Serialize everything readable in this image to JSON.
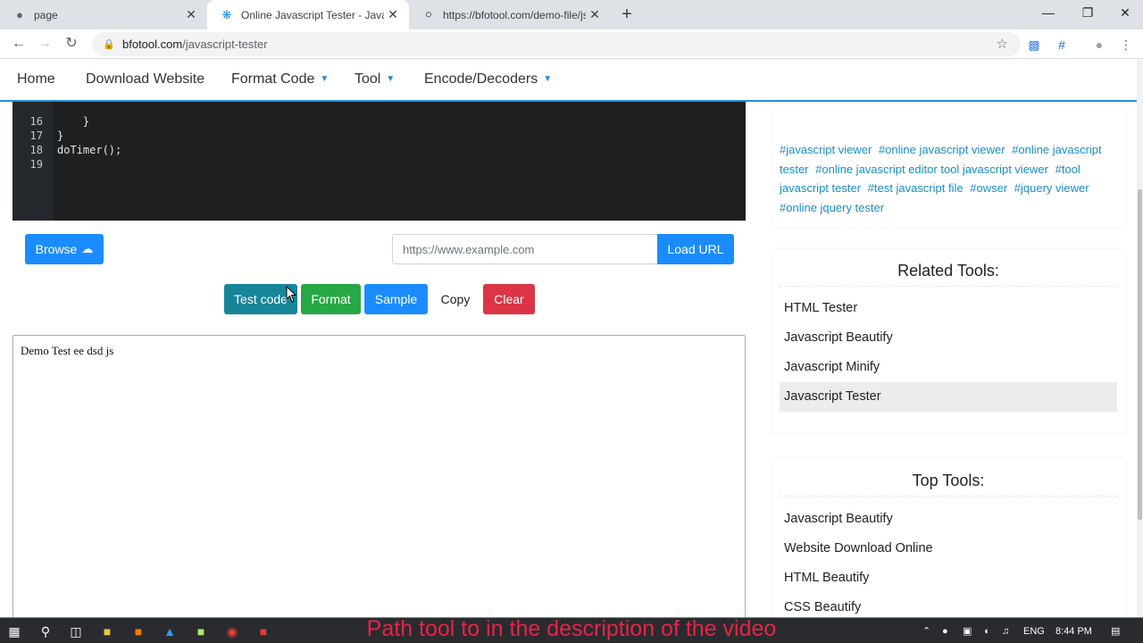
{
  "browser": {
    "tabs": [
      {
        "title": "page",
        "icon": "github-icon"
      },
      {
        "title": "Online Javascript Tester - Javascri",
        "icon": "bfotool-icon"
      },
      {
        "title": "https://bfotool.com/demo-file/js",
        "icon": "globe-icon"
      }
    ],
    "url_host": "bfotool.com",
    "url_path": "/javascript-tester"
  },
  "nav": {
    "home": "Home",
    "download": "Download Website",
    "format": "Format Code",
    "tool": "Tool",
    "encode": "Encode/Decoders",
    "caret": "▼"
  },
  "editor": {
    "lines": [
      {
        "num": "16",
        "text": "    }"
      },
      {
        "num": "17",
        "text": "}"
      },
      {
        "num": "18",
        "text": "doTimer();"
      },
      {
        "num": "19",
        "text": ""
      }
    ]
  },
  "controls": {
    "browse": "Browse",
    "url_placeholder": "https://www.example.com",
    "load_url": "Load URL",
    "test_code": "Test code",
    "format": "Format",
    "sample": "Sample",
    "copy": "Copy",
    "clear": "Clear"
  },
  "output": {
    "text": "Demo Test ee dsd js"
  },
  "sidebar": {
    "tags": [
      "#javascript viewer",
      "#online javascript viewer",
      "#online javascript tester",
      "#online javascript editor tool javascript viewer",
      "#tool javascript tester",
      "#test javascript file",
      "#owser",
      "#jquery viewer",
      "#online jquery tester"
    ],
    "related_title": "Related Tools:",
    "related": [
      "HTML Tester",
      "Javascript Beautify",
      "Javascript Minify",
      "Javascript Tester"
    ],
    "top_title": "Top Tools:",
    "top": [
      "Javascript Beautify",
      "Website Download Online",
      "HTML Beautify",
      "CSS Beautify"
    ]
  },
  "taskbar": {
    "lang": "ENG",
    "time": "8:44 PM"
  },
  "overlay_text": "Path tool to in the description of the video"
}
